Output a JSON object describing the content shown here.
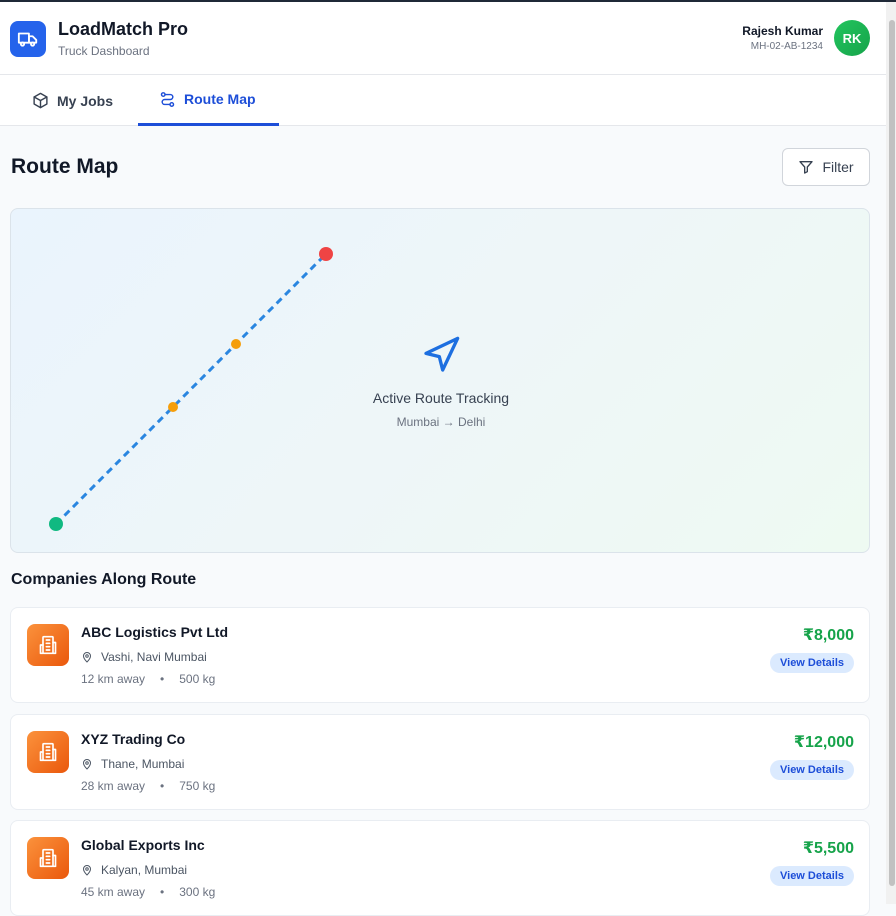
{
  "header": {
    "app_title": "LoadMatch Pro",
    "app_subtitle": "Truck Dashboard",
    "user_name": "Rajesh Kumar",
    "user_id": "MH-02-AB-1234",
    "avatar_initials": "RK",
    "logo_icon": "truck-icon"
  },
  "tabs": [
    {
      "label": "My Jobs",
      "icon": "package-icon",
      "active": false
    },
    {
      "label": "Route Map",
      "icon": "route-icon",
      "active": true
    }
  ],
  "page": {
    "title": "Route Map",
    "filter_label": "Filter"
  },
  "map": {
    "title": "Active Route Tracking",
    "subtitle": "Mumbai → Delhi",
    "icon": "navigation-icon",
    "colors": {
      "route": "#2a86e0",
      "start": "#10b981",
      "end": "#ef4444",
      "stop": "#f59e0b"
    }
  },
  "companies": {
    "section_title": "Companies Along Route",
    "items": [
      {
        "name": "ABC Logistics Pvt Ltd",
        "location": "Vashi, Navi Mumbai",
        "distance": "12 km away",
        "weight": "500 kg",
        "price": "₹8,000",
        "action": "View Details"
      },
      {
        "name": "XYZ Trading Co",
        "location": "Thane, Mumbai",
        "distance": "28 km away",
        "weight": "750 kg",
        "price": "₹12,000",
        "action": "View Details"
      },
      {
        "name": "Global Exports Inc",
        "location": "Kalyan, Mumbai",
        "distance": "45 km away",
        "weight": "300 kg",
        "price": "₹5,500",
        "action": "View Details"
      }
    ],
    "separator": "•"
  },
  "colors": {
    "accent": "#1d4ed8",
    "price": "#16a34a",
    "company_icon": "#f97316"
  }
}
